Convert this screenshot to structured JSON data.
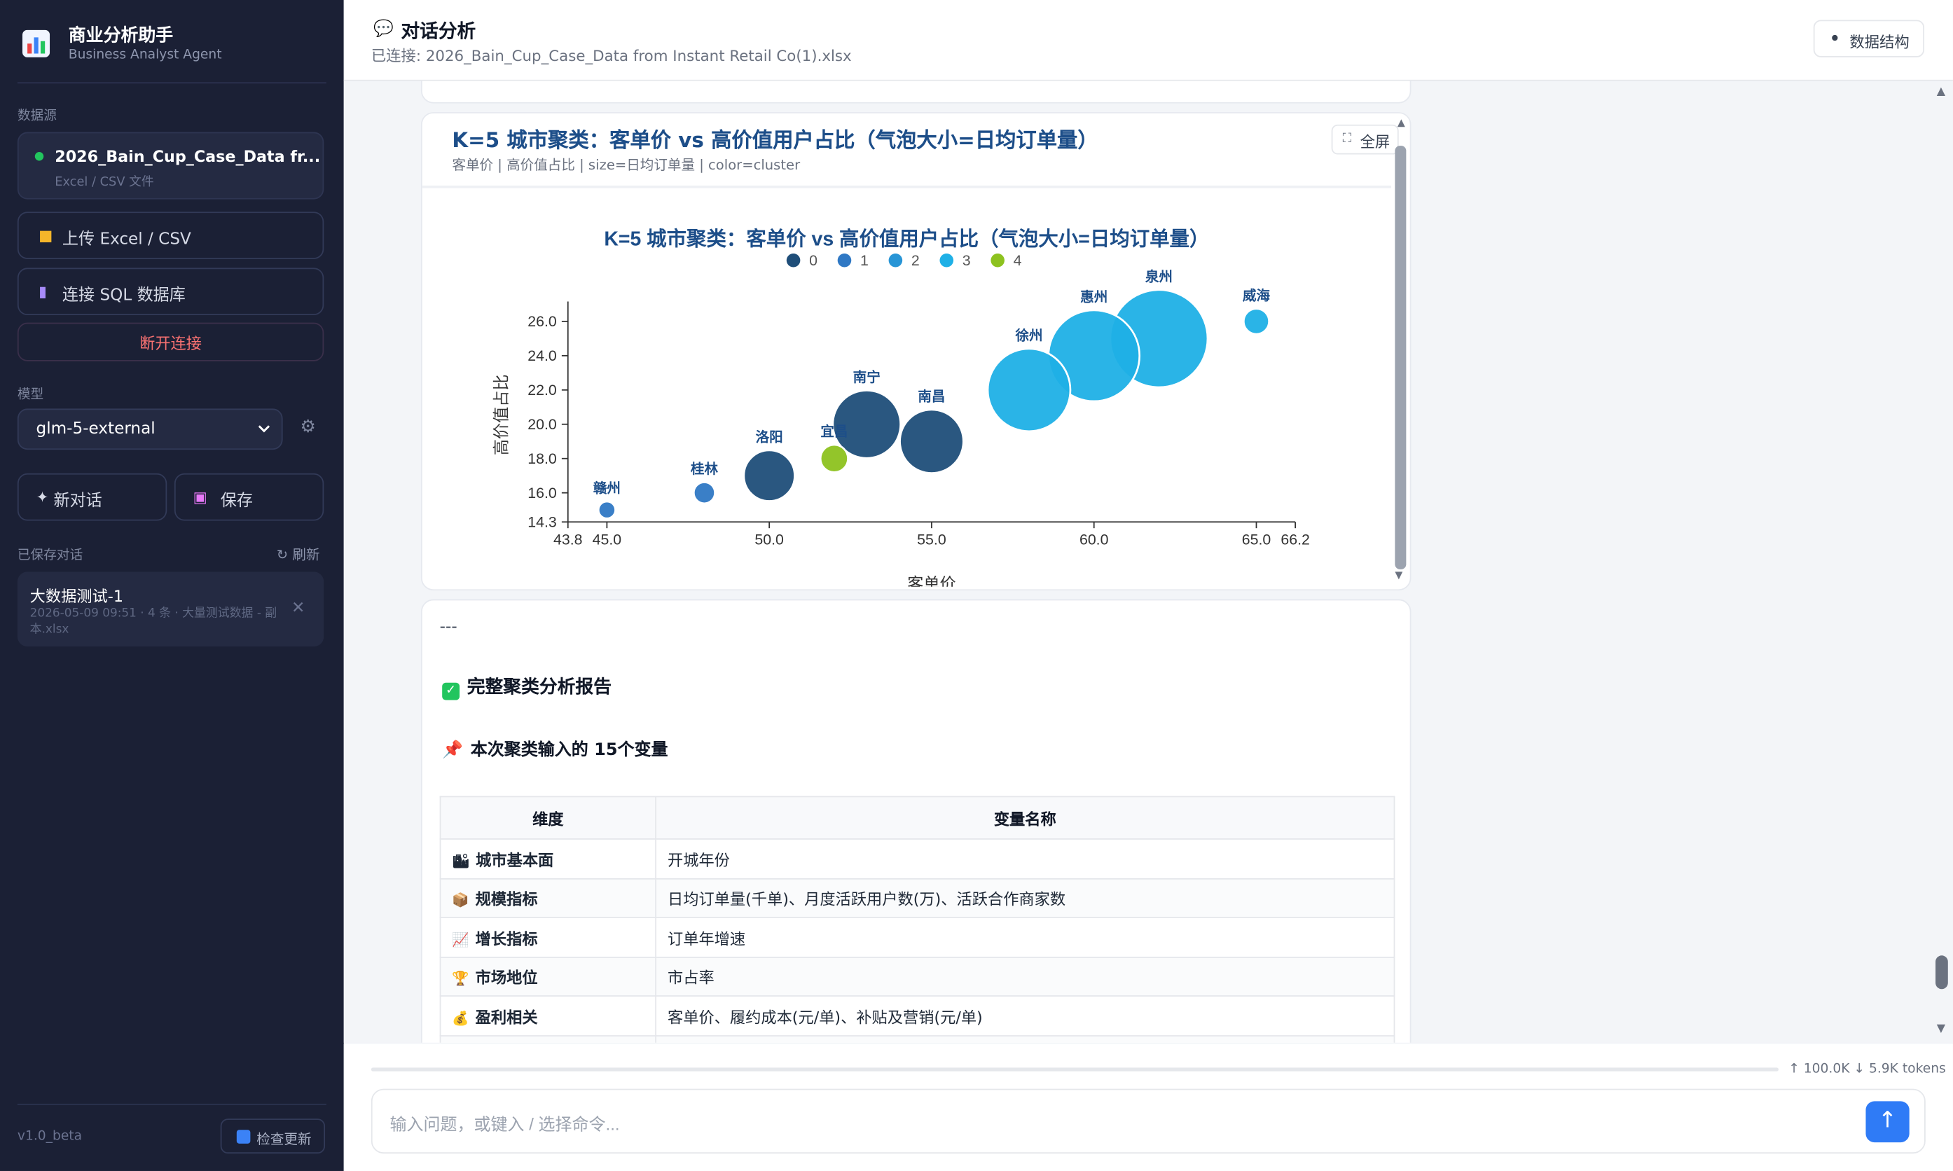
{
  "app": {
    "title": "商业分析助手",
    "subtitle": "Business Analyst Agent"
  },
  "sidebar": {
    "datasource_label": "数据源",
    "datasource": {
      "name": "2026_Bain_Cup_Case_Data fr...",
      "type": "Excel / CSV 文件"
    },
    "upload_label": "上传 Excel / CSV",
    "sql_label": "连接 SQL 数据库",
    "disconnect_label": "断开连接",
    "model_label": "模型",
    "model_value": "glm-5-external",
    "new_chat_label": "新对话",
    "save_label": "保存",
    "saved_label": "已保存对话",
    "refresh_label": "刷新",
    "conversation": {
      "title": "大数据测试-1",
      "meta": "2026-05-09 09:51 · 4 条 · 大量测试数据 - 副本.xlsx"
    },
    "version": "v1.0_beta",
    "update_label": "检查更新"
  },
  "header": {
    "title": "对话分析",
    "subtitle": "已连接: 2026_Bain_Cup_Case_Data from Instant Retail Co(1).xlsx",
    "schema_label": "数据结构"
  },
  "chart_card": {
    "title": "K=5 城市聚类：客单价 vs 高价值用户占比（气泡大小=日均订单量）",
    "subtitle": "客单价 | 高价值占比 | size=日均订单量 | color=cluster",
    "fullscreen_label": "全屏"
  },
  "chart_data": {
    "type": "scatter",
    "title": "K=5 城市聚类：客单价 vs 高价值用户占比（气泡大小=日均订单量）",
    "xlabel": "客单价",
    "ylabel": "高价值占比",
    "xlim": [
      43.8,
      66.2
    ],
    "ylim": [
      14.3,
      26.8
    ],
    "xticks": [
      43.8,
      45.0,
      50.0,
      55.0,
      60.0,
      65.0,
      66.2
    ],
    "yticks": [
      14.3,
      16.0,
      18.0,
      20.0,
      22.0,
      24.0,
      26.0
    ],
    "legend_position": "top",
    "grid": false,
    "series": [
      {
        "name": "0",
        "color": "#1f4e79",
        "points": [
          {
            "label": "洛阳",
            "x": 50.0,
            "y": 17.0,
            "size": 2.4
          },
          {
            "label": "南宁",
            "x": 53.0,
            "y": 20.0,
            "size": 3.2
          },
          {
            "label": "南昌",
            "x": 55.0,
            "y": 19.0,
            "size": 3.0
          }
        ]
      },
      {
        "name": "1",
        "color": "#2f78c4",
        "points": [
          {
            "label": "赣州",
            "x": 45.0,
            "y": 15.0,
            "size": 0.8
          },
          {
            "label": "桂林",
            "x": 48.0,
            "y": 16.0,
            "size": 1.0
          }
        ]
      },
      {
        "name": "2",
        "color": "#2895d6",
        "points": []
      },
      {
        "name": "3",
        "color": "#1fb0e6",
        "points": [
          {
            "label": "徐州",
            "x": 58.0,
            "y": 22.0,
            "size": 3.9
          },
          {
            "label": "惠州",
            "x": 60.0,
            "y": 24.0,
            "size": 4.3
          },
          {
            "label": "泉州",
            "x": 62.0,
            "y": 25.0,
            "size": 4.6
          },
          {
            "label": "威海",
            "x": 65.0,
            "y": 26.0,
            "size": 1.2
          }
        ]
      },
      {
        "name": "4",
        "color": "#8dc21f",
        "points": [
          {
            "label": "宜昌",
            "x": 52.0,
            "y": 18.0,
            "size": 1.3
          }
        ]
      }
    ]
  },
  "report": {
    "divider": "---",
    "heading": "完整聚类分析报告",
    "subheading": "本次聚类输入的 15个变量",
    "table": {
      "headers": [
        "维度",
        "变量名称"
      ],
      "rows": [
        {
          "dimension": "城市基本面",
          "variables": "开城年份"
        },
        {
          "dimension": "规模指标",
          "variables": "日均订单量(千单)、月度活跃用户数(万)、活跃合作商家数"
        },
        {
          "dimension": "增长指标",
          "variables": "订单年增速"
        },
        {
          "dimension": "市场地位",
          "variables": "市占率"
        },
        {
          "dimension": "盈利相关",
          "variables": "客单价、履约成本(元/单)、补贴及营销(元/单)"
        }
      ]
    }
  },
  "footer": {
    "token_usage": "↑ 100.0K ↓ 5.9K tokens",
    "input_placeholder": "输入问题，或键入 / 选择命令..."
  }
}
